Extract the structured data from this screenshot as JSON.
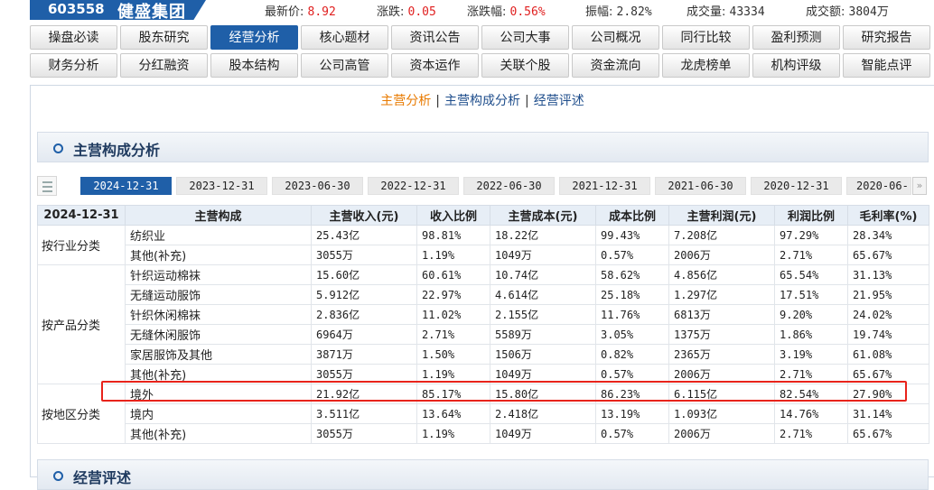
{
  "header": {
    "stock_code": "603558",
    "stock_name": "健盛集团",
    "quotes": [
      {
        "label": "最新价:",
        "value": "8.92",
        "color": "red"
      },
      {
        "label": "涨跌:",
        "value": "0.05",
        "color": "red"
      },
      {
        "label": "涨跌幅:",
        "value": "0.56%",
        "color": "red"
      },
      {
        "label": "振幅:",
        "value": "2.82%",
        "color": "black"
      },
      {
        "label": "成交量:",
        "value": "43334",
        "color": "black"
      },
      {
        "label": "成交额:",
        "value": "3804万",
        "color": "black"
      }
    ]
  },
  "nav": {
    "row1": [
      "操盘必读",
      "股东研究",
      "经营分析",
      "核心题材",
      "资讯公告",
      "公司大事",
      "公司概况",
      "同行比较",
      "盈利预测",
      "研究报告"
    ],
    "row2": [
      "财务分析",
      "分红融资",
      "股本结构",
      "公司高管",
      "资本运作",
      "关联个股",
      "资金流向",
      "龙虎榜单",
      "机构评级",
      "智能点评"
    ],
    "active": "经营分析"
  },
  "subtabs": [
    "主营分析",
    "主营构成分析",
    "经营评述"
  ],
  "section_title": "主营构成分析",
  "section2_title": "经营评述",
  "dates": [
    "2024-12-31",
    "2023-12-31",
    "2023-06-30",
    "2022-12-31",
    "2022-06-30",
    "2021-12-31",
    "2021-06-30",
    "2020-12-31",
    "2020-06-"
  ],
  "table": {
    "headers": [
      "2024-12-31",
      "主营构成",
      "主营收入(元)",
      "收入比例",
      "主营成本(元)",
      "成本比例",
      "主营利润(元)",
      "利润比例",
      "毛利率(%)"
    ],
    "groups": [
      {
        "name": "按行业分类",
        "rows": [
          [
            "纺织业",
            "25.43亿",
            "98.81%",
            "18.22亿",
            "99.43%",
            "7.208亿",
            "97.29%",
            "28.34%"
          ],
          [
            "其他(补充)",
            "3055万",
            "1.19%",
            "1049万",
            "0.57%",
            "2006万",
            "2.71%",
            "65.67%"
          ]
        ]
      },
      {
        "name": "按产品分类",
        "rows": [
          [
            "针织运动棉袜",
            "15.60亿",
            "60.61%",
            "10.74亿",
            "58.62%",
            "4.856亿",
            "65.54%",
            "31.13%"
          ],
          [
            "无缝运动服饰",
            "5.912亿",
            "22.97%",
            "4.614亿",
            "25.18%",
            "1.297亿",
            "17.51%",
            "21.95%"
          ],
          [
            "针织休闲棉袜",
            "2.836亿",
            "11.02%",
            "2.155亿",
            "11.76%",
            "6813万",
            "9.20%",
            "24.02%"
          ],
          [
            "无缝休闲服饰",
            "6964万",
            "2.71%",
            "5589万",
            "3.05%",
            "1375万",
            "1.86%",
            "19.74%"
          ],
          [
            "家居服饰及其他",
            "3871万",
            "1.50%",
            "1506万",
            "0.82%",
            "2365万",
            "3.19%",
            "61.08%"
          ],
          [
            "其他(补充)",
            "3055万",
            "1.19%",
            "1049万",
            "0.57%",
            "2006万",
            "2.71%",
            "65.67%"
          ]
        ]
      },
      {
        "name": "按地区分类",
        "rows": [
          [
            "境外",
            "21.92亿",
            "85.17%",
            "15.80亿",
            "86.23%",
            "6.115亿",
            "82.54%",
            "27.90%"
          ],
          [
            "境内",
            "3.511亿",
            "13.64%",
            "2.418亿",
            "13.19%",
            "1.093亿",
            "14.76%",
            "31.14%"
          ],
          [
            "其他(补充)",
            "3055万",
            "1.19%",
            "1049万",
            "0.57%",
            "2006万",
            "2.71%",
            "65.67%"
          ]
        ]
      }
    ]
  },
  "colors": {
    "primary": "#1f5fa8",
    "accent_red": "#e02020",
    "subtab_active": "#e87a00",
    "highlight": "#e8231b"
  }
}
